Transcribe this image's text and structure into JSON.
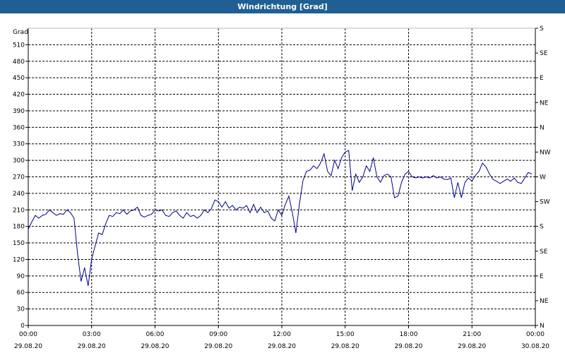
{
  "window": {
    "title": "Windrichtung [Grad]"
  },
  "chart_data": {
    "type": "line",
    "title": "Windrichtung [Grad]",
    "ylabel": "Grad",
    "ylim": [
      0,
      540
    ],
    "y_ticks": [
      0,
      30,
      60,
      90,
      120,
      150,
      180,
      210,
      240,
      270,
      300,
      330,
      360,
      390,
      420,
      450,
      480,
      510
    ],
    "y2_ticks": [
      {
        "value": 0,
        "label": "N"
      },
      {
        "value": 45,
        "label": "NE"
      },
      {
        "value": 90,
        "label": "E"
      },
      {
        "value": 135,
        "label": "SE"
      },
      {
        "value": 180,
        "label": "S"
      },
      {
        "value": 225,
        "label": "SW"
      },
      {
        "value": 270,
        "label": "W"
      },
      {
        "value": 315,
        "label": "NW"
      },
      {
        "value": 360,
        "label": "N"
      },
      {
        "value": 405,
        "label": "NE"
      },
      {
        "value": 450,
        "label": "E"
      },
      {
        "value": 495,
        "label": "SE"
      },
      {
        "value": 540,
        "label": "S"
      }
    ],
    "xlim": [
      "29.08.20 00:00",
      "30.08.20 00:00"
    ],
    "x_ticks": [
      {
        "time": "00:00",
        "date": "29.08.20"
      },
      {
        "time": "03:00",
        "date": "29.08.20"
      },
      {
        "time": "06:00",
        "date": "29.08.20"
      },
      {
        "time": "09:00",
        "date": "29.08.20"
      },
      {
        "time": "12:00",
        "date": "29.08.20"
      },
      {
        "time": "15:00",
        "date": "29.08.20"
      },
      {
        "time": "18:00",
        "date": "29.08.20"
      },
      {
        "time": "21:00",
        "date": "29.08.20"
      },
      {
        "time": "00:00",
        "date": "30.08.20"
      }
    ],
    "grid": true,
    "line_color": "#00008b",
    "series": [
      {
        "x": [
          "00:00",
          "00:10",
          "00:20",
          "00:30",
          "00:40",
          "00:50",
          "01:00",
          "01:10",
          "01:20",
          "01:30",
          "01:40",
          "01:50",
          "02:00",
          "02:10",
          "02:20",
          "02:30",
          "02:40",
          "02:50",
          "03:00",
          "03:10",
          "03:20",
          "03:30",
          "03:40",
          "03:50",
          "04:00",
          "04:10",
          "04:20",
          "04:30",
          "04:40",
          "04:50",
          "05:00",
          "05:10",
          "05:20",
          "05:30",
          "05:40",
          "05:50",
          "06:00",
          "06:10",
          "06:20",
          "06:30",
          "06:40",
          "06:50",
          "07:00",
          "07:10",
          "07:20",
          "07:30",
          "07:40",
          "07:50",
          "08:00",
          "08:10",
          "08:20",
          "08:30",
          "08:40",
          "08:50",
          "09:00",
          "09:10",
          "09:20",
          "09:30",
          "09:40",
          "09:50",
          "10:00",
          "10:10",
          "10:20",
          "10:30",
          "10:40",
          "10:50",
          "11:00",
          "11:10",
          "11:20",
          "11:30",
          "11:40",
          "11:50",
          "12:00",
          "12:10",
          "12:20",
          "12:30",
          "12:40",
          "12:50",
          "13:00",
          "13:10",
          "13:20",
          "13:30",
          "13:40",
          "13:50",
          "14:00",
          "14:10",
          "14:20",
          "14:30",
          "14:40",
          "14:50",
          "15:00",
          "15:10",
          "15:20",
          "15:30",
          "15:40",
          "15:50",
          "16:00",
          "16:10",
          "16:20",
          "16:30",
          "16:40",
          "16:50",
          "17:00",
          "17:10",
          "17:20",
          "17:30",
          "17:40",
          "17:50",
          "18:00",
          "18:10",
          "18:20",
          "18:30",
          "18:40",
          "18:50",
          "19:00",
          "19:10",
          "19:20",
          "19:30",
          "19:40",
          "19:50",
          "20:00",
          "20:10",
          "20:20",
          "20:30",
          "20:40",
          "20:50",
          "21:00",
          "21:10",
          "21:20",
          "21:30",
          "21:40",
          "21:50",
          "22:00",
          "22:10",
          "22:20",
          "22:30",
          "22:40",
          "22:50",
          "23:00",
          "23:10",
          "23:20",
          "23:30",
          "23:40",
          "23:50"
        ],
        "y": [
          175,
          188,
          200,
          195,
          200,
          202,
          210,
          205,
          200,
          203,
          202,
          210,
          205,
          195,
          130,
          80,
          105,
          72,
          120,
          145,
          168,
          165,
          185,
          200,
          198,
          205,
          203,
          210,
          202,
          208,
          210,
          215,
          200,
          197,
          200,
          202,
          210,
          208,
          210,
          200,
          198,
          205,
          208,
          200,
          195,
          205,
          198,
          200,
          195,
          200,
          210,
          205,
          212,
          228,
          225,
          215,
          225,
          213,
          218,
          210,
          215,
          213,
          218,
          205,
          220,
          205,
          215,
          205,
          208,
          195,
          190,
          210,
          200,
          220,
          235,
          205,
          168,
          220,
          263,
          280,
          282,
          290,
          285,
          295,
          312,
          280,
          272,
          300,
          285,
          305,
          315,
          318,
          245,
          275,
          260,
          270,
          290,
          280,
          305,
          270,
          260,
          272,
          275,
          270,
          232,
          235,
          260,
          275,
          280,
          270,
          268,
          270,
          268,
          270,
          268,
          272,
          268,
          270,
          266,
          265,
          268,
          232,
          260,
          232,
          260,
          268,
          262,
          273,
          280,
          295,
          288,
          275,
          265,
          262,
          258,
          262,
          266,
          262,
          268,
          260,
          258,
          268,
          278,
          275
        ]
      }
    ]
  }
}
